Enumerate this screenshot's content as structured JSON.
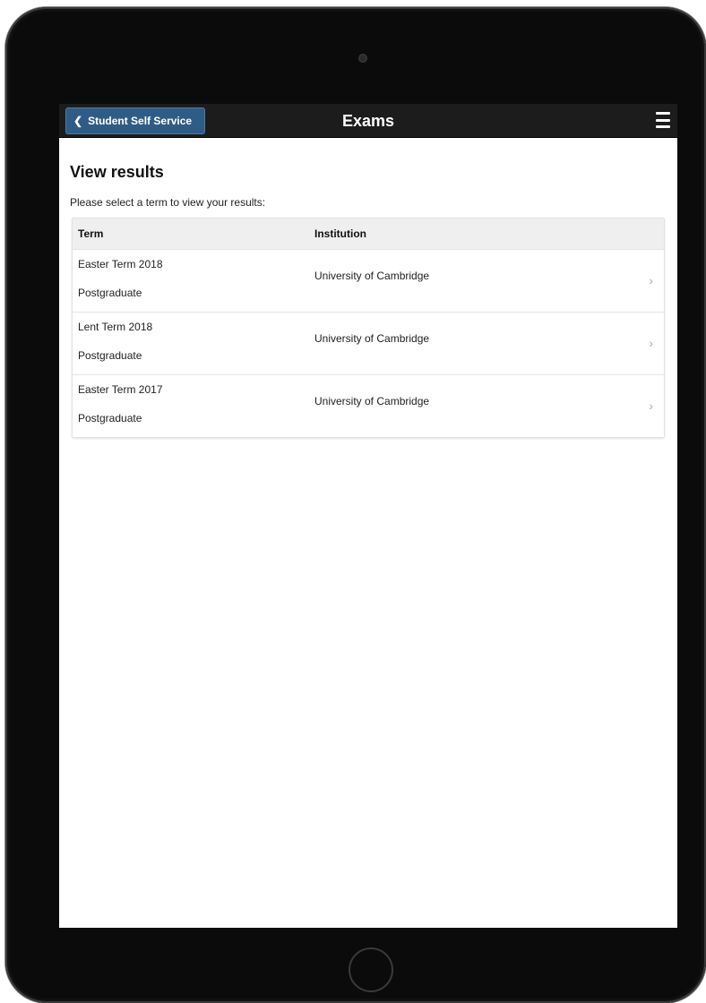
{
  "header": {
    "back_label": "Student Self Service",
    "back_icon": "chevron-left-icon",
    "title": "Exams",
    "menu_icon": "hamburger-menu-icon"
  },
  "main": {
    "page_title": "View results",
    "instruction": "Please select a term to view your results:",
    "table": {
      "columns": [
        "Term",
        "Institution"
      ],
      "rows": [
        {
          "term": "Easter Term 2018",
          "level": "Postgraduate",
          "institution": "University of Cambridge"
        },
        {
          "term": "Lent Term 2018",
          "level": "Postgraduate",
          "institution": "University of Cambridge"
        },
        {
          "term": "Easter Term 2017",
          "level": "Postgraduate",
          "institution": "University of Cambridge"
        }
      ]
    }
  },
  "colors": {
    "topbar": "#1c1c1c",
    "back_button": "#2f5c86",
    "table_header": "#efefef"
  }
}
